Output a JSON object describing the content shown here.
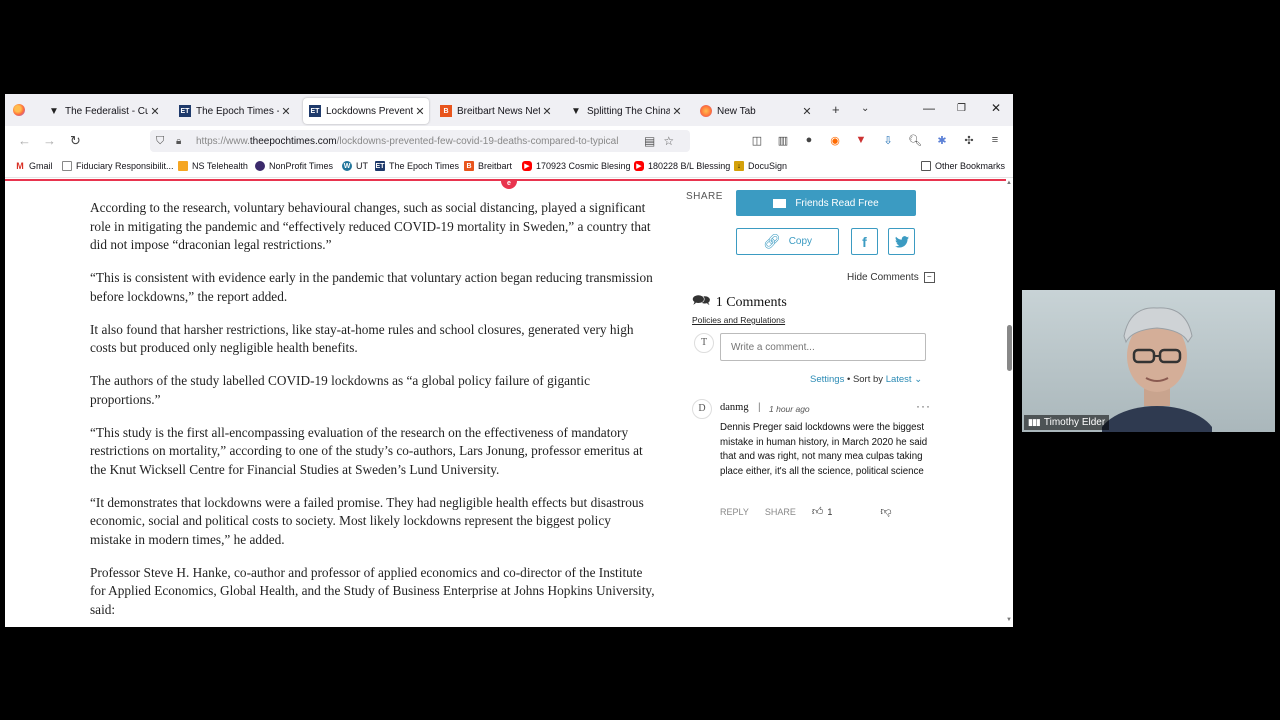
{
  "tabs": [
    {
      "label": "The Federalist - Cultur",
      "fav_text": "▼",
      "fav_color": "#222"
    },
    {
      "label": "The Epoch Times - Trut",
      "fav_text": "ET",
      "fav_color": "#1f3a6b"
    },
    {
      "label": "Lockdowns Prevented",
      "fav_text": "ET",
      "fav_color": "#1f3a6b",
      "active": true
    },
    {
      "label": "Breitbart News Networ",
      "fav_text": "B",
      "fav_color": "#e8551d"
    },
    {
      "label": "Splitting The China-Ru",
      "fav_text": "▼",
      "fav_color": "#222"
    },
    {
      "label": "New Tab",
      "fav_text": "",
      "fav_color": "#ff7139"
    }
  ],
  "url": {
    "prefix": "https://www.",
    "domain": "theepochtimes.com",
    "path": "/lockdowns-prevented-few-covid-19-deaths-compared-to-typical"
  },
  "bookmarks": [
    {
      "label": "Gmail",
      "icon": "M",
      "color": "#d93025"
    },
    {
      "label": "Fiduciary Responsibilit...",
      "icon": "",
      "color": "#888"
    },
    {
      "label": "NS Telehealth",
      "icon": "",
      "color": "#f5a623"
    },
    {
      "label": "NonProfit Times",
      "icon": "",
      "color": "#3b2a6b"
    },
    {
      "label": "UT",
      "icon": "W",
      "color": "#21759b"
    },
    {
      "label": "The Epoch Times",
      "icon": "ET",
      "color": "#1f3a6b"
    },
    {
      "label": "Breitbart",
      "icon": "B",
      "color": "#e8551d"
    },
    {
      "label": "170923 Cosmic Blesing",
      "icon": "▶",
      "color": "#ff0000"
    },
    {
      "label": "180228 B/L Blessing",
      "icon": "▶",
      "color": "#ff0000"
    },
    {
      "label": "DocuSign",
      "icon": "↓",
      "color": "#d4a10b"
    }
  ],
  "other_bookmarks": "Other Bookmarks",
  "article": {
    "paragraphs": [
      "According to the research, voluntary behavioural changes, such as social distancing, played a significant role in mitigating the pandemic and “effectively reduced COVID-19 mortality in Sweden,” a country that did not impose “draconian legal restrictions.”",
      "“This is consistent with evidence early in the pandemic that voluntary action began reducing transmission before lockdowns,” the report added.",
      "It also found that harsher restrictions, like stay-at-home rules and school closures, generated very high costs but produced only negligible health benefits.",
      "The authors of the study labelled COVID-19 lockdowns as “a global policy failure of gigantic proportions.”",
      "“This study is the first all-encompassing evaluation of the research on the effectiveness of mandatory restrictions on mortality,” according to one of the study’s co-authors, Lars Jonung, professor emeritus at the Knut Wicksell Centre for Financial Studies at Sweden’s Lund University.",
      "“It demonstrates that lockdowns were a failed promise. They had negligible health effects but disastrous economic, social and political costs to society. Most likely lockdowns represent the biggest policy mistake in modern times,” he added.",
      "Professor Steve H. Hanke, co-author and professor of applied economics and co-director of the Institute for Applied Economics, Global Health, and the Study of Business Enterprise at Johns Hopkins University, said:"
    ]
  },
  "sidebar": {
    "share_label": "SHARE",
    "friends_read_free": "Friends Read Free",
    "copy_label": "Copy",
    "facebook": "f",
    "hide_comments": "Hide Comments",
    "comments_count": "1 Comments",
    "policies_link": "Policies and Regulations",
    "user_initial": "T",
    "comment_placeholder": "Write a comment...",
    "settings_label": "Settings",
    "sort_by_label": "Sort by",
    "sort_value": "Latest"
  },
  "comment": {
    "initial": "D",
    "user": "danmg",
    "time": "1 hour ago",
    "text": "Dennis Preger said lockdowns were the biggest mistake in human history, in March 2020 he said that and was right, not many mea culpas taking place either, it's all the science, political science",
    "reply": "REPLY",
    "share": "SHARE",
    "likes": "1"
  },
  "webcam": {
    "name": "Timothy Elder"
  },
  "colors": {
    "accent": "#3b9bc2",
    "epoch_red": "#e8344e"
  }
}
